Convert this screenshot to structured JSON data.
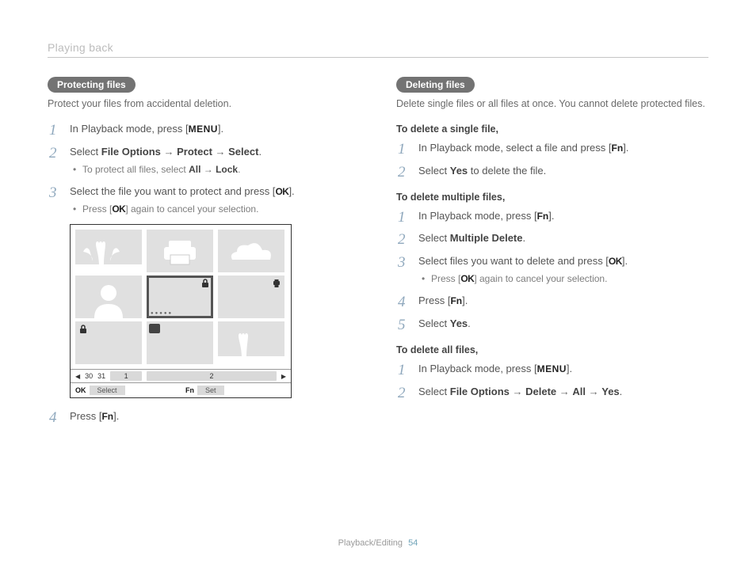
{
  "header": "Playing back",
  "footer": {
    "section": "Playback/Editing",
    "page": "54"
  },
  "keys": {
    "menu": "MENU",
    "ok": "OK",
    "fn": "Fn"
  },
  "left": {
    "pill": "Protecting files",
    "intro": "Protect your files from accidental deletion.",
    "s1": {
      "a": "In Playback mode, press [",
      "b": "]."
    },
    "s2": {
      "a": "Select ",
      "b": "File Options",
      "c": " → ",
      "d": "Protect",
      "e": " → ",
      "f": "Select",
      "g": ".",
      "sub_a": "To protect all files, select ",
      "sub_b": "All",
      "sub_c": " → ",
      "sub_d": "Lock",
      "sub_e": "."
    },
    "s3": {
      "a": "Select the file you want to protect and press [",
      "b": "].",
      "sub_a": "Press [",
      "sub_b": "] again to cancel your selection."
    },
    "s4": {
      "a": "Press [",
      "b": "]."
    }
  },
  "screen": {
    "dates": [
      "30",
      "31",
      "1",
      "2"
    ],
    "bar": {
      "select_key": "OK",
      "select_lbl": "Select",
      "set_key": "Fn",
      "set_lbl": "Set"
    }
  },
  "right": {
    "pill": "Deleting files",
    "intro": "Delete single files or all files at once. You cannot delete protected files.",
    "h1": "To delete a single file,",
    "single1": {
      "a": "In Playback mode, select a file and press [",
      "b": "]."
    },
    "single2": {
      "a": "Select ",
      "b": "Yes",
      "c": " to delete the file."
    },
    "h2": "To delete multiple files,",
    "m1": {
      "a": "In Playback mode, press [",
      "b": "]."
    },
    "m2": {
      "a": "Select ",
      "b": "Multiple Delete",
      "c": "."
    },
    "m3": {
      "a": "Select files you want to delete and press [",
      "b": "].",
      "sub_a": "Press [",
      "sub_b": "] again to cancel your selection."
    },
    "m4": {
      "a": "Press [",
      "b": "]."
    },
    "m5": {
      "a": "Select ",
      "b": "Yes",
      "c": "."
    },
    "h3": "To delete all files,",
    "a1": {
      "a": "In Playback mode, press [",
      "b": "]."
    },
    "a2": {
      "a": "Select ",
      "b": "File Options",
      "c": " → ",
      "d": "Delete",
      "e": " → ",
      "f": "All",
      "g": " → ",
      "h": "Yes",
      "i": "."
    }
  }
}
